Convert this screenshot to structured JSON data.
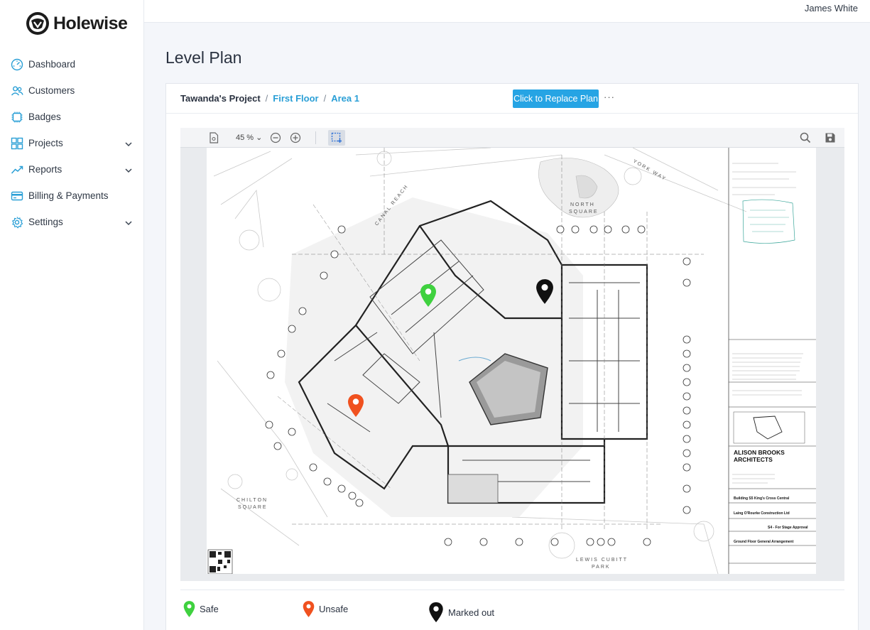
{
  "app": {
    "name": "Holewise"
  },
  "user": {
    "name": "James White"
  },
  "sidebar": {
    "items": [
      {
        "label": "Dashboard",
        "icon": "dashboard-icon",
        "has_submenu": false
      },
      {
        "label": "Customers",
        "icon": "customers-icon",
        "has_submenu": false
      },
      {
        "label": "Badges",
        "icon": "badges-icon",
        "has_submenu": false
      },
      {
        "label": "Projects",
        "icon": "projects-icon",
        "has_submenu": true
      },
      {
        "label": "Reports",
        "icon": "reports-icon",
        "has_submenu": true
      },
      {
        "label": "Billing & Payments",
        "icon": "billing-icon",
        "has_submenu": false
      },
      {
        "label": "Settings",
        "icon": "settings-icon",
        "has_submenu": true
      }
    ]
  },
  "page": {
    "title": "Level Plan"
  },
  "breadcrumb": {
    "root": "Tawanda's Project",
    "sep": "/",
    "level": "First Floor",
    "area": "Area 1"
  },
  "actions": {
    "replace_plan": "Click to Replace Plan",
    "more": "···"
  },
  "viewer": {
    "zoom": "45 %"
  },
  "plan_labels": {
    "north_square": "NORTH\nSQUARE",
    "north": "NORTH",
    "square": "SQUARE",
    "chilton": "CHILTON",
    "chilton_square": "SQUARE",
    "lewis_cubitt": "LEWIS CUBITT",
    "park": "PARK",
    "canal_reach": "CANAL REACH",
    "york_way": "YORK WAY",
    "architect_line1": "ALISON BROOKS",
    "architect_line2": "ARCHITECTS",
    "project_name": "Building S5 King's Cross Central",
    "client": "Laing O'Rourke Construction Ltd",
    "drawing_title": "Ground Floor General Arrangement",
    "stage": "S4 - For Stage Approval"
  },
  "legend": {
    "safe": "Safe",
    "unsafe": "Unsafe",
    "marked_out": "Marked out"
  },
  "colors": {
    "safe": "#3fd13f",
    "unsafe": "#f0511f",
    "marked_out": "#111111",
    "accent": "#26a4e4"
  }
}
